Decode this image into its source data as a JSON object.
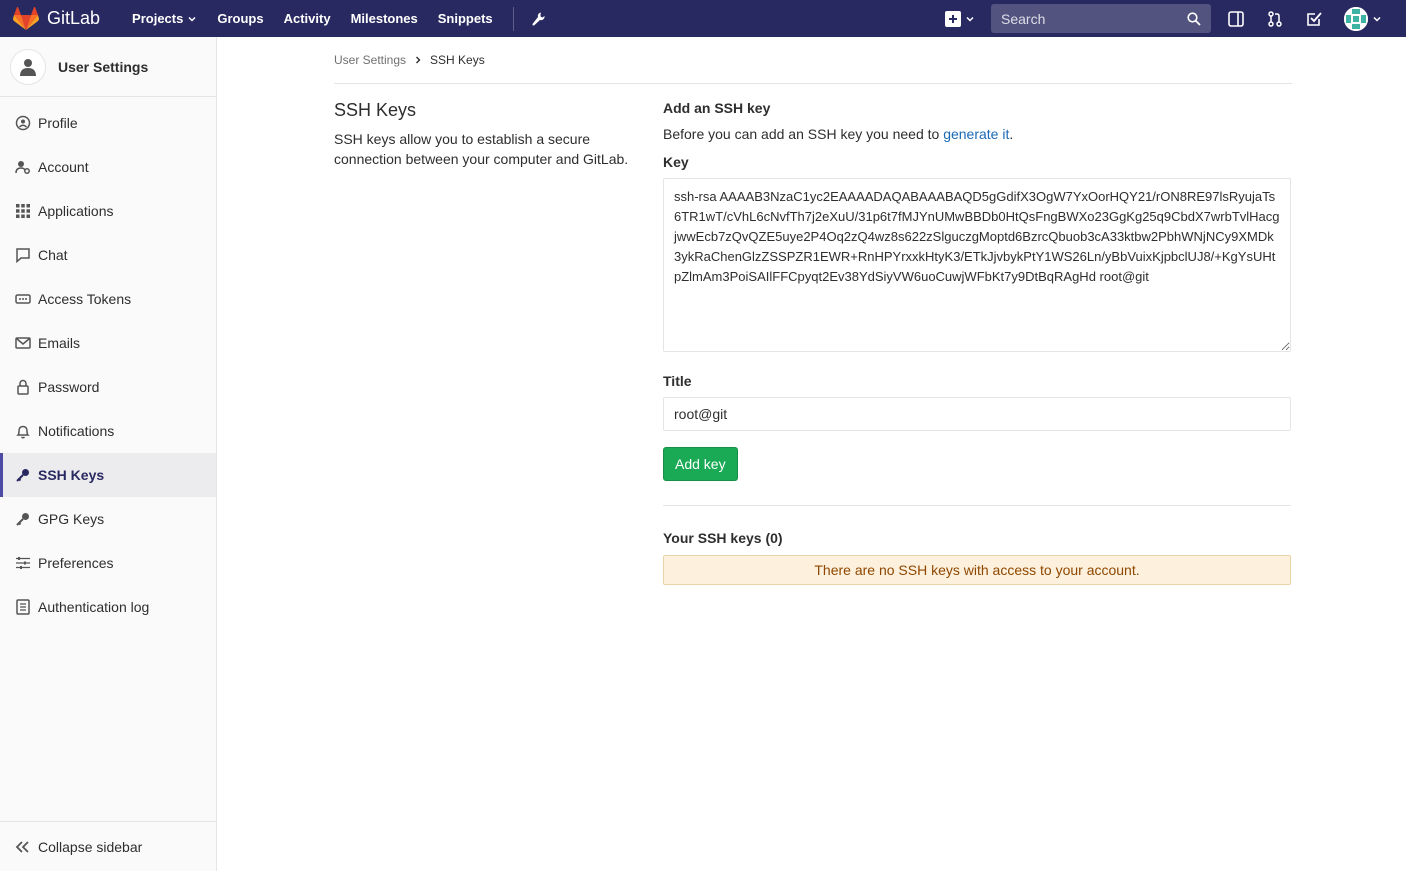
{
  "navbar": {
    "brand": "GitLab",
    "links": [
      {
        "label": "Projects",
        "has_dropdown": true
      },
      {
        "label": "Groups"
      },
      {
        "label": "Activity"
      },
      {
        "label": "Milestones"
      },
      {
        "label": "Snippets"
      }
    ],
    "search_placeholder": "Search"
  },
  "sidebar": {
    "title": "User Settings",
    "items": [
      {
        "label": "Profile",
        "icon": "profile-icon"
      },
      {
        "label": "Account",
        "icon": "account-icon"
      },
      {
        "label": "Applications",
        "icon": "applications-icon"
      },
      {
        "label": "Chat",
        "icon": "chat-icon"
      },
      {
        "label": "Access Tokens",
        "icon": "token-icon"
      },
      {
        "label": "Emails",
        "icon": "mail-icon"
      },
      {
        "label": "Password",
        "icon": "lock-icon"
      },
      {
        "label": "Notifications",
        "icon": "bell-icon"
      },
      {
        "label": "SSH Keys",
        "icon": "key-icon",
        "active": true
      },
      {
        "label": "GPG Keys",
        "icon": "key-icon"
      },
      {
        "label": "Preferences",
        "icon": "preferences-icon"
      },
      {
        "label": "Authentication log",
        "icon": "log-icon"
      }
    ],
    "collapse_label": "Collapse sidebar"
  },
  "breadcrumb": {
    "parent": "User Settings",
    "current": "SSH Keys"
  },
  "intro": {
    "title": "SSH Keys",
    "description": "SSH keys allow you to establish a secure connection between your computer and GitLab."
  },
  "form": {
    "heading": "Add an SSH key",
    "help_prefix": "Before you can add an SSH key you need to ",
    "help_link": "generate it",
    "help_suffix": ".",
    "key_label": "Key",
    "key_value": "ssh-rsa AAAAB3NzaC1yc2EAAAADAQABAAABAQD5gGdifX3OgW7YxOorHQY21/rON8RE97lsRyujaTs6TR1wT/cVhL6cNvfTh7j2eXuU/31p6t7fMJYnUMwBBDb0HtQsFngBWXo23GgKg25q9CbdX7wrbTvlHacgjwwEcb7zQvQZE5uye2P4Oq2zQ4wz8s622zSlguczgMoptd6BzrcQbuob3cA33ktbw2PbhWNjNCy9XMDk3ykRaChenGlzZSSPZR1EWR+RnHPYrxxkHtyK3/ETkJjvbykPtY1WS26Ln/yBbVuixKjpbclUJ8/+KgYsUHtpZlmAm3PoiSAIlFFCpyqt2Ev38YdSiyVW6uoCuwjWFbKt7y9DtBqRAgHd root@git",
    "title_label": "Title",
    "title_value": "root@git",
    "submit_label": "Add key"
  },
  "keys": {
    "heading": "Your SSH keys (0)",
    "empty_message": "There are no SSH keys with access to your account."
  },
  "colors": {
    "navbar_bg": "#292961",
    "accent": "#4b4ba3",
    "success": "#1aaa55",
    "link": "#1b69b6",
    "warning_bg": "#fdf1dd"
  }
}
